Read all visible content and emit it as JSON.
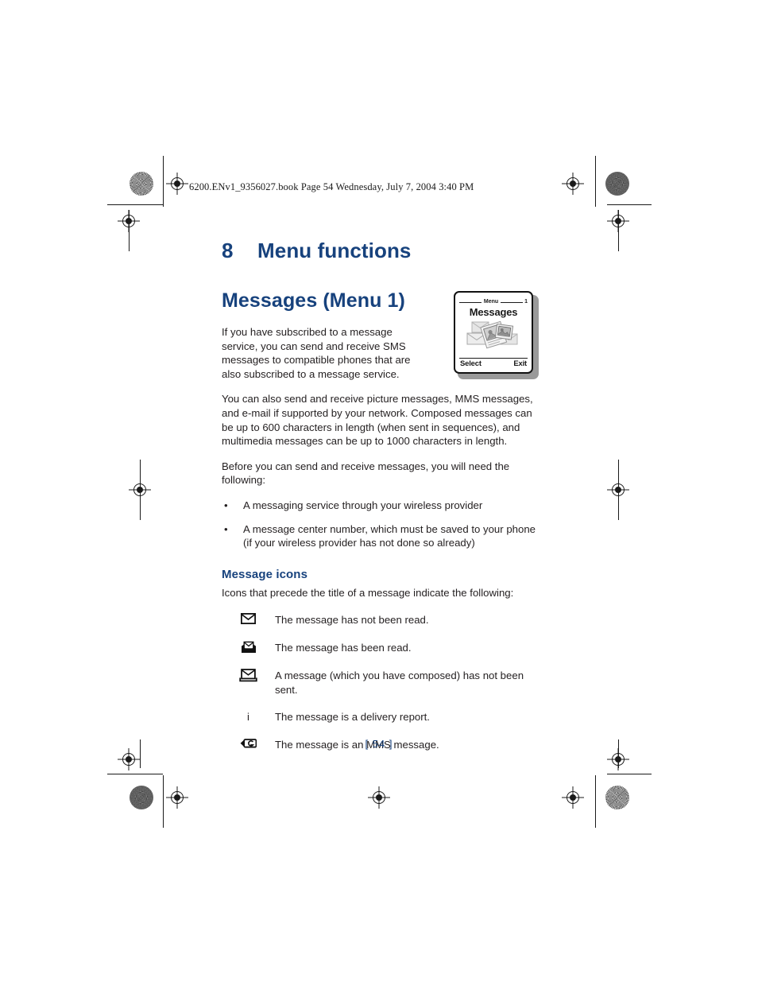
{
  "print_header": "6200.ENv1_9356027.book  Page 54  Wednesday, July 7, 2004  3:40 PM",
  "colors": {
    "heading_blue": "#17427d",
    "body_text": "#231f20",
    "page_background": "#ffffff"
  },
  "chapter": {
    "number": "8",
    "title": "Menu functions"
  },
  "section": {
    "title": "Messages (Menu 1)",
    "intro_paragraph": "If you have subscribed to a message service, you can send and receive SMS messages to compatible phones that are also subscribed to a message service.",
    "paragraph_2": "You can also send and receive picture messages, MMS messages, and e-mail if supported by your network. Composed messages can be up to 600 characters in length (when sent in sequences), and multimedia messages can be up to 1000 characters in length.",
    "paragraph_3": "Before you can send and receive messages, you will need the following:",
    "bullets": [
      "A messaging service through your wireless provider",
      "A message center number, which must be saved to your phone (if your wireless provider has not done so already)"
    ]
  },
  "subsection": {
    "title": "Message icons",
    "intro": "Icons that precede the title of a message indicate the following:",
    "rows": [
      {
        "icon": "closed-envelope-icon",
        "glyph": "",
        "text": "The message has not been read."
      },
      {
        "icon": "open-envelope-icon",
        "glyph": "",
        "text": "The message has been read."
      },
      {
        "icon": "unsent-envelope-icon",
        "glyph": "",
        "text": "A message (which you have composed) has not been sent."
      },
      {
        "icon": "delivery-report-icon",
        "glyph": "i",
        "text": "The message is a delivery report."
      },
      {
        "icon": "mms-message-icon",
        "glyph": "",
        "text": "The message is an MMS message."
      }
    ]
  },
  "phone_illustration": {
    "menu_label": "Menu",
    "menu_index": "1",
    "screen_title": "Messages",
    "left_softkey": "Select",
    "right_softkey": "Exit"
  },
  "footer": {
    "page_number": "[ 54 ]"
  }
}
